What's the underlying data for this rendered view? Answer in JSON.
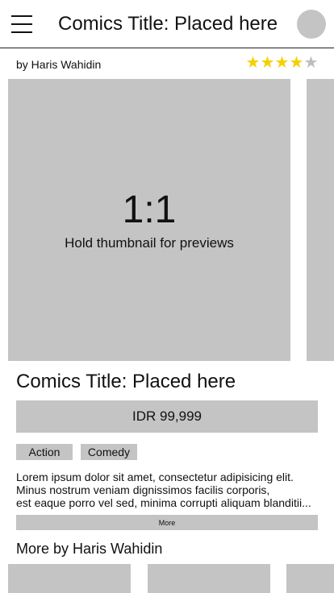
{
  "header": {
    "title": "Comics Title: Placed here"
  },
  "author": {
    "byline": "by Haris Wahidin"
  },
  "rating": {
    "value": 4,
    "max": 5,
    "filled_star": "★",
    "empty_star": "★",
    "filled_color": "#f5d000",
    "empty_color": "#bdbdbd"
  },
  "thumbnail": {
    "ratio": "1:1",
    "hint": "Hold thumbnail for previews"
  },
  "comic": {
    "title": "Comics Title: Placed here",
    "price": "IDR 99,999",
    "tags": [
      "Action",
      "Comedy"
    ],
    "description_lines": [
      "Lorem ipsum dolor sit amet, consectetur adipisicing elit.",
      "Minus nostrum veniam dignissimos facilis corporis,",
      "est eaque porro vel sed, minima corrupti aliquam blanditii..."
    ],
    "more_label": "More"
  },
  "more_by": {
    "heading": "More by Haris Wahidin"
  },
  "colors": {
    "placeholder": "#c4c4c4",
    "text": "#111111",
    "background": "#ffffff"
  }
}
